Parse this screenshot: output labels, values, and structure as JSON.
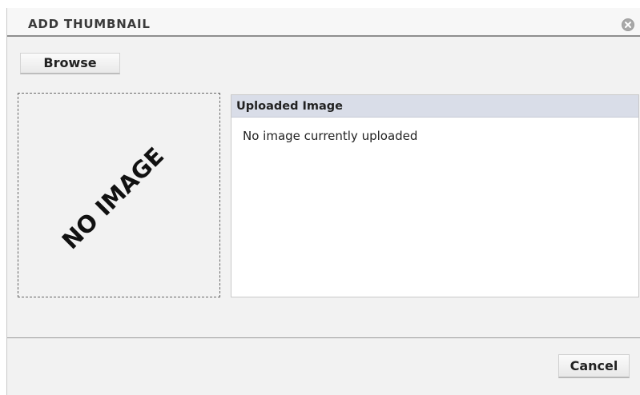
{
  "dialog": {
    "title": "ADD THUMBNAIL",
    "close_icon": "close-circle-icon"
  },
  "actions": {
    "browse_label": "Browse",
    "cancel_label": "Cancel"
  },
  "preview": {
    "placeholder_text": "NO IMAGE"
  },
  "uploaded": {
    "title": "Uploaded Image",
    "message": "No image currently uploaded"
  },
  "colors": {
    "dialog_background": "#f2f2f2",
    "panel_header": "#d9dde8",
    "close_icon": "#a8a8a8"
  }
}
